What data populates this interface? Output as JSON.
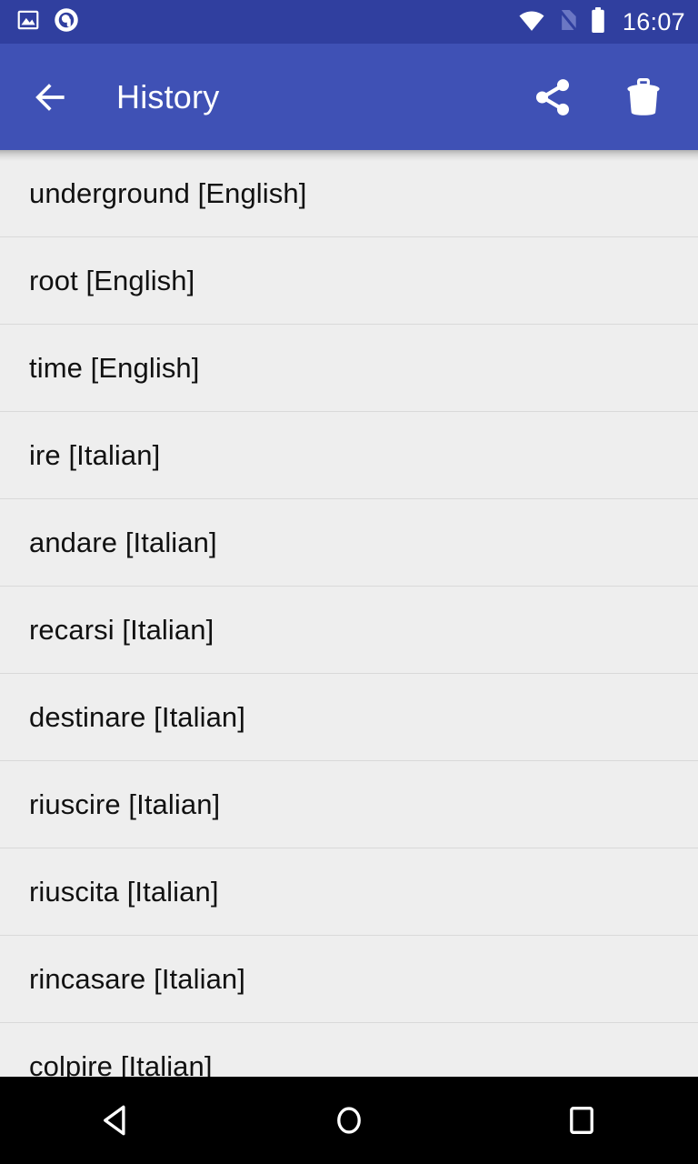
{
  "status_bar": {
    "background_color": "#303f9f",
    "time": "16:07",
    "left_icons": [
      {
        "name": "image-notification-icon",
        "label": "Screenshot"
      },
      {
        "name": "app-notification-icon",
        "label": "App notification"
      }
    ],
    "right_icons": [
      {
        "name": "wifi-icon",
        "label": "Wi-Fi connected"
      },
      {
        "name": "no-sim-icon",
        "label": "No SIM card"
      },
      {
        "name": "battery-icon",
        "label": "Battery full"
      }
    ]
  },
  "app_bar": {
    "background_color": "#3f51b5",
    "title": "History",
    "back_label": "Navigate up",
    "share_label": "Share",
    "delete_label": "Delete history"
  },
  "list": {
    "background_color": "#eeeeee",
    "divider_color": "#d9d9d9",
    "items": [
      {
        "label": "underground [English]",
        "term": "underground",
        "language": "English"
      },
      {
        "label": "root [English]",
        "term": "root",
        "language": "English"
      },
      {
        "label": "time [English]",
        "term": "time",
        "language": "English"
      },
      {
        "label": "ire [Italian]",
        "term": "ire",
        "language": "Italian"
      },
      {
        "label": "andare [Italian]",
        "term": "andare",
        "language": "Italian"
      },
      {
        "label": "recarsi [Italian]",
        "term": "recarsi",
        "language": "Italian"
      },
      {
        "label": "destinare [Italian]",
        "term": "destinare",
        "language": "Italian"
      },
      {
        "label": "riuscire [Italian]",
        "term": "riuscire",
        "language": "Italian"
      },
      {
        "label": "riuscita [Italian]",
        "term": "riuscita",
        "language": "Italian"
      },
      {
        "label": "rincasare [Italian]",
        "term": "rincasare",
        "language": "Italian"
      },
      {
        "label": "colpire [Italian]",
        "term": "colpire",
        "language": "Italian"
      }
    ]
  },
  "nav_bar": {
    "background_color": "#000000",
    "buttons": [
      {
        "name": "nav-back-button",
        "label": "Back"
      },
      {
        "name": "nav-home-button",
        "label": "Home"
      },
      {
        "name": "nav-recents-button",
        "label": "Recent apps"
      }
    ]
  }
}
